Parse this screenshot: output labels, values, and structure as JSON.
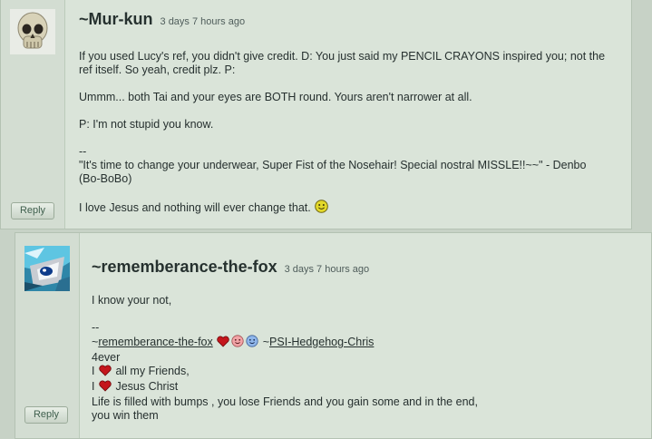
{
  "comments": [
    {
      "username": "~Mur-kun",
      "time": "3 days 7 hours ago",
      "reply_label": "Reply",
      "avatar_icon": "skull-icon",
      "lines": {
        "l1": "If you used Lucy's ref, you didn't give credit. D: You just said my PENCIL CRAYONS inspired you; not the ref itself. So yeah, credit plz. P:",
        "l2": "Ummm... both Tai and your eyes are BOTH round. Yours aren't narrower at all.",
        "l3": "P: I'm not stupid you know.",
        "sep": "--",
        "quote": "\"It's time to change your underwear, Super Fist of the Nosehair! Special nostral MISSLE!!~~\" - Denbo (Bo-BoBo)",
        "sig": "I love Jesus and nothing will ever change that."
      }
    },
    {
      "username": "~rememberance-the-fox",
      "time": "3 days 7 hours ago",
      "reply_label": "Reply",
      "avatar_icon": "blue-fox-icon",
      "lines": {
        "l1": "I know your not,",
        "sep": "--",
        "tilde1": "~",
        "link1": "rememberance-the-fox",
        "tilde2": "~",
        "link2": "PSI-Hedgehog-Chris",
        "ever": "4ever",
        "i1": "I",
        "friends": "all my Friends,",
        "i2": "I",
        "jesus": "Jesus Christ",
        "life1": "Life is filled with bumps , you lose Friends and you gain some and in the end,",
        "life2": "you win them"
      }
    }
  ],
  "colors": {
    "panel": "#dae4d9",
    "background": "#c7d2c6",
    "heart": "#c4161c"
  }
}
